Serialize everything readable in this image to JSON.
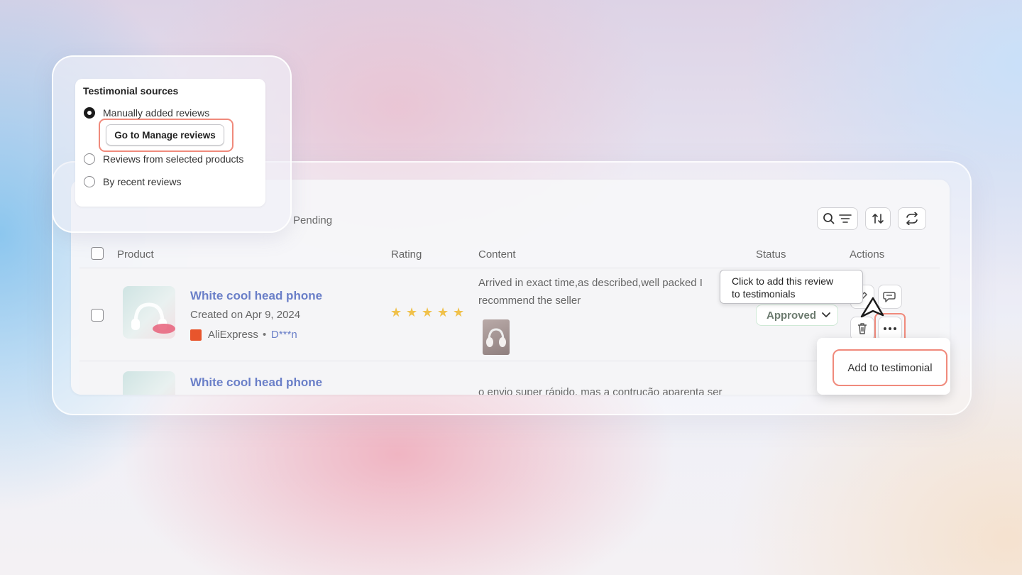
{
  "sources": {
    "title": "Testimonial sources",
    "options": [
      {
        "label": "Manually added reviews",
        "selected": true
      },
      {
        "label": "Reviews from selected products",
        "selected": false
      },
      {
        "label": "By recent reviews",
        "selected": false
      }
    ],
    "manage_button": "Go to Manage reviews"
  },
  "toolbar": {
    "tab_pending": "Pending",
    "search_icon": "search-filter-icon",
    "sort_icon": "sort-icon",
    "refresh_icon": "refresh-icon"
  },
  "table": {
    "headers": {
      "product": "Product",
      "rating": "Rating",
      "content": "Content",
      "status": "Status",
      "actions": "Actions"
    },
    "rows": [
      {
        "title": "White cool head phone",
        "created": "Created on Apr 9, 2024",
        "source": "AliExpress",
        "separator": "•",
        "author": "D***n",
        "rating": 5,
        "content_line1": "Arrived in exact time,as described,well packed I",
        "content_line2": "recommend the seller",
        "status": "Approved"
      },
      {
        "title": "White cool head phone",
        "content_line1": "o envio super rápido, mas a contrução aparenta ser"
      }
    ]
  },
  "tooltip": {
    "line1": "Click to add this review",
    "line2": "to testimonials"
  },
  "menu": {
    "add_to_testimonial": "Add to testimonial"
  },
  "colors": {
    "accent_highlight": "#f08a7c",
    "link": "#6a7fc8",
    "star": "#f0c14b",
    "aliexpress": "#e8552c"
  }
}
